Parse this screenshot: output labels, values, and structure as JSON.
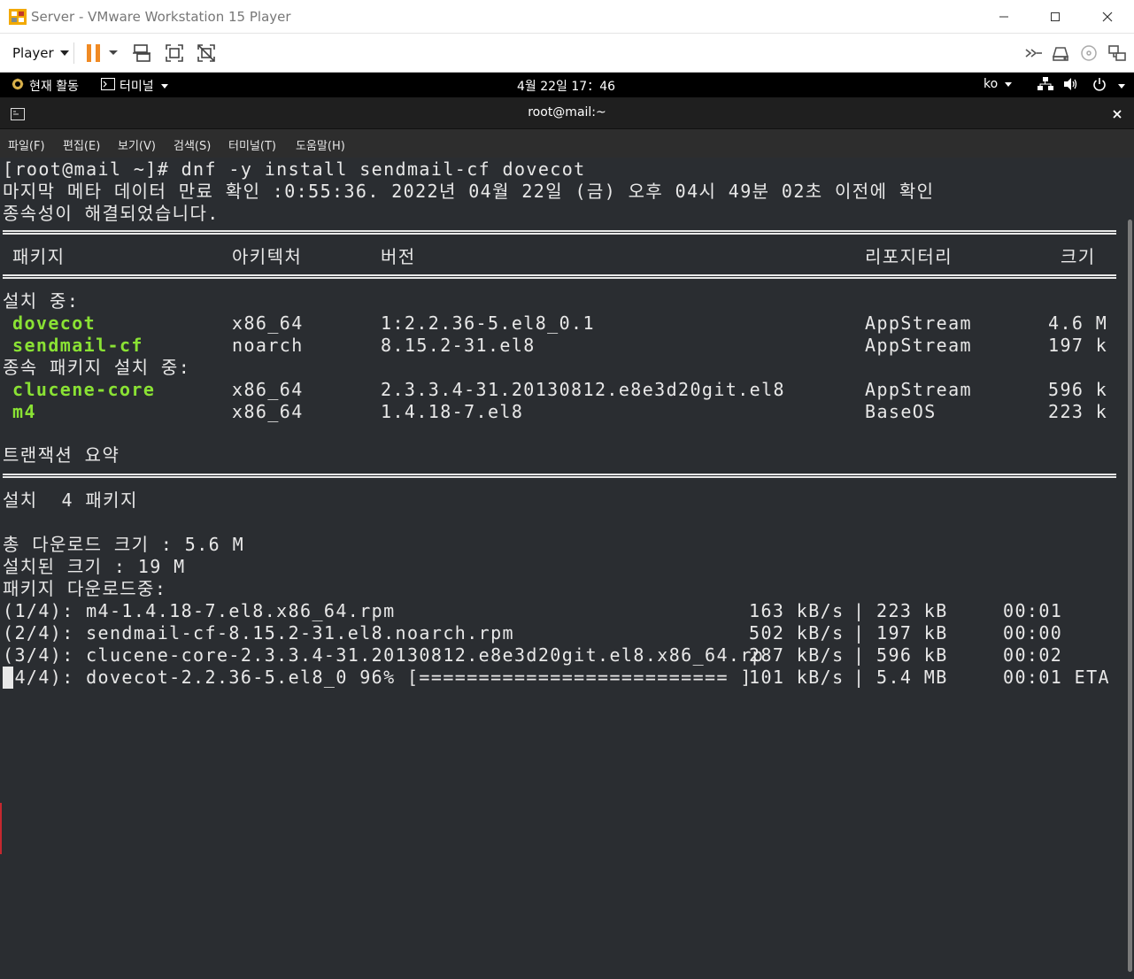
{
  "vmware": {
    "title": "Server - VMware Workstation 15 Player",
    "player_menu": "Player",
    "accent": "#f08a24"
  },
  "gnome": {
    "activities": "현재 활동",
    "terminal_menu": "터미널",
    "datetime": "4월 22일  17：46",
    "lang": "ko"
  },
  "terminal": {
    "title": "root@mail:~",
    "menu": [
      "파일(F)",
      "편집(E)",
      "보기(V)",
      "검색(S)",
      "터미널(T)",
      "도움말(H)"
    ],
    "command_line": "[root@mail ~]# dnf -y install sendmail-cf dovecot",
    "meta_line": "마지막 메타 데이터 만료 확인 :0:55:36. 2022년 04월 22일 (금) 오후 04시 49분 02초 이전에 확인",
    "deps_resolved": "종속성이 해결되었습니다.",
    "headers": {
      "package": "패키지",
      "arch": "아키텍처",
      "version": "버전",
      "repo": "리포지터리",
      "size": "크기"
    },
    "installing_label": "설치 중:",
    "installing": [
      {
        "name": "dovecot",
        "arch": "x86_64",
        "version": "1:2.2.36-5.el8_0.1",
        "repo": "AppStream",
        "size": "4.6 M"
      },
      {
        "name": "sendmail-cf",
        "arch": "noarch",
        "version": "8.15.2-31.el8",
        "repo": "AppStream",
        "size": "197 k"
      }
    ],
    "deps_label": "종속 패키지 설치 중:",
    "deps": [
      {
        "name": "clucene-core",
        "arch": "x86_64",
        "version": "2.3.3.4-31.20130812.e8e3d20git.el8",
        "repo": "AppStream",
        "size": "596 k"
      },
      {
        "name": "m4",
        "arch": "x86_64",
        "version": "1.4.18-7.el8",
        "repo": "BaseOS",
        "size": "223 k"
      }
    ],
    "summary_label": "트랜잭션 요약",
    "summary_install": "설치  4 패키지",
    "total_download": "총 다운로드 크기 : 5.6 M",
    "installed_size": "설치된 크기 : 19 M",
    "downloading_label": "패키지 다운로드중:",
    "downloads": [
      {
        "name": "(1/4): m4-1.4.18-7.el8.x86_64.rpm",
        "speed": "163 kB/s",
        "sep": "|",
        "size": "223 kB",
        "time": "00:01"
      },
      {
        "name": "(2/4): sendmail-cf-8.15.2-31.el8.noarch.rpm",
        "speed": "502 kB/s",
        "sep": "|",
        "size": "197 kB",
        "time": "00:00"
      },
      {
        "name": "(3/4): clucene-core-2.3.3.4-31.20130812.e8e3d20git.el8.x86_64.rp",
        "speed": "287 kB/s",
        "sep": "|",
        "size": "596 kB",
        "time": "00:02"
      },
      {
        "name": "(4/4): dovecot-2.2.36-5.el8_0 96% [========================== ]",
        "speed": "101 kB/s",
        "sep": "|",
        "size": "5.4 MB",
        "time": "00:01 ETA"
      }
    ],
    "current_progress_percent": 96
  }
}
